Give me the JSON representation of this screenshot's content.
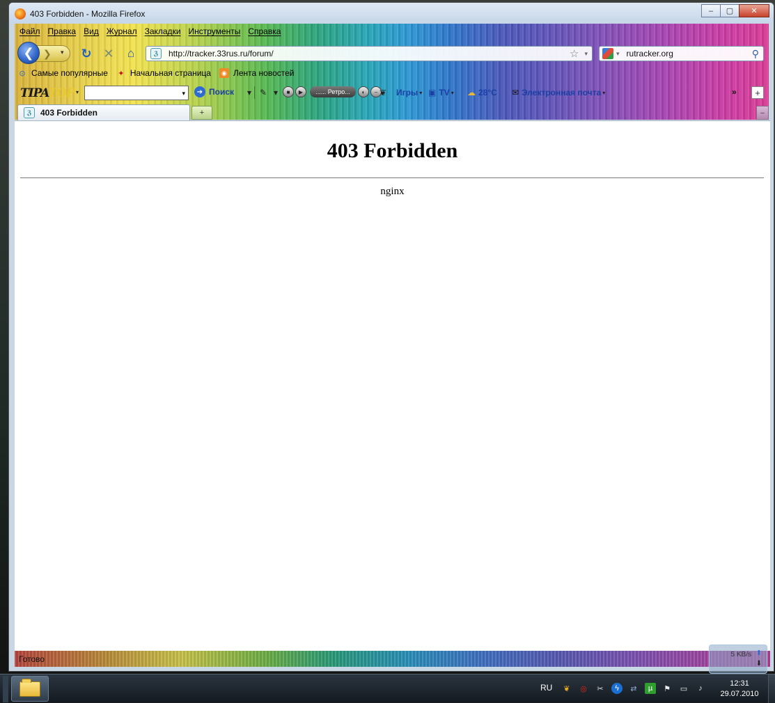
{
  "window": {
    "title": "403 Forbidden - Mozilla Firefox",
    "minimize_glyph": "–",
    "maximize_glyph": "▢",
    "close_glyph": "✕"
  },
  "menu": {
    "items": [
      "Файл",
      "Правка",
      "Вид",
      "Журнал",
      "Закладки",
      "Инструменты",
      "Справка"
    ]
  },
  "nav": {
    "back_glyph": "❮",
    "forward_glyph": "❯",
    "dropdown_glyph": "▾",
    "reload_glyph": "↻",
    "stop_glyph": "✕",
    "home_glyph": "⌂",
    "url": "http://tracker.33rus.ru/forum/",
    "site_icon_glyph": "ℨ",
    "star_glyph": "☆",
    "search_engine_value": "rutracker.org",
    "search_glyph": "⚲"
  },
  "bookmarks": [
    {
      "label": "Самые популярные",
      "icon": "popular-icon",
      "glyph": "⊙"
    },
    {
      "label": "Начальная страница",
      "icon": "start-page-icon",
      "glyph": "✦"
    },
    {
      "label": "Лента новостей",
      "icon": "rss-feed-icon",
      "glyph": "◉"
    }
  ],
  "toolbar": {
    "logo_part1": "TIPA",
    "logo_part2": "TOP",
    "search_label": "Поиск",
    "search_glyph": "➔",
    "radio_station": "...... Ретро...",
    "games_label": "Игры",
    "tv_label": "TV",
    "weather_label": "28°C",
    "mail_label": "Электронная почта",
    "more_glyph": "»",
    "plus_glyph": "+"
  },
  "tabs": {
    "active_label": "403 Forbidden",
    "new_tab_glyph": "+",
    "tab_menu_glyph": "–"
  },
  "page": {
    "heading": "403 Forbidden",
    "server": "nginx"
  },
  "status": {
    "text": "Готово"
  },
  "netmeter": {
    "speed": "5 KB/s"
  },
  "taskbar": {
    "language": "RU",
    "time": "12:31",
    "date": "29.07.2010"
  },
  "colors": {
    "link_blue": "#1a3fa5",
    "window_frame": "#c9d6e3",
    "content_bg": "#ffffff"
  }
}
